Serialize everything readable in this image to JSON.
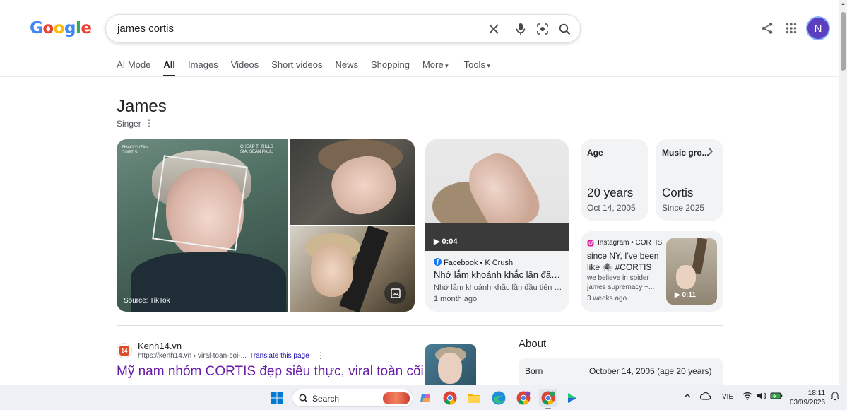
{
  "header": {
    "logo_letters": [
      {
        "ch": "G",
        "color": "#4285F4"
      },
      {
        "ch": "o",
        "color": "#EA4335"
      },
      {
        "ch": "o",
        "color": "#FBBC05"
      },
      {
        "ch": "g",
        "color": "#4285F4"
      },
      {
        "ch": "l",
        "color": "#34A853"
      },
      {
        "ch": "e",
        "color": "#EA4335"
      }
    ],
    "search_query": "james cortis",
    "avatar_letter": "N"
  },
  "tabs": [
    "AI Mode",
    "All",
    "Images",
    "Videos",
    "Short videos",
    "News",
    "Shopping",
    "More",
    "Tools"
  ],
  "active_tab": "All",
  "knowledge_panel": {
    "title": "James",
    "subtitle": "Singer",
    "main_image": {
      "caption_left": "ZHAO YUFAN\nCORTIS",
      "caption_right": "CHEAP THRILLS\nSIA, SEAN PAUL",
      "source": "Source: TikTok"
    },
    "facebook_card": {
      "duration": "0:04",
      "source": "Facebook • K Crush",
      "title": "Nhớ lắm khoảnh khắc lần đầu tiên...",
      "desc": "Nhớ lắm khoảnh khắc lần đầu tiên James...",
      "ago": "1 month ago"
    },
    "age_card": {
      "label": "Age",
      "value": "20 years",
      "sub": "Oct 14, 2005"
    },
    "music_card": {
      "label": "Music gro...",
      "value": "Cortis",
      "sub": "Since 2025"
    },
    "instagram_card": {
      "source": "Instagram • CORTIS",
      "title": "since NY, I've been like 🕷️ #CORTIS #...",
      "desc": "we believe in spider james supremacy ~...",
      "ago": "3 weeks ago",
      "duration": "0:11"
    }
  },
  "result": {
    "site": "Kenh14.vn",
    "url": "https://kenh14.vn › viral-toan-coi-...",
    "translate": "Translate this page",
    "title": "Mỹ nam nhóm CORTIS đẹp siêu thực, viral toàn cõi",
    "favicon_text": "14"
  },
  "about": {
    "heading": "About",
    "born_label": "Born",
    "born_value": "October 14, 2005 (age 20 years)"
  },
  "taskbar": {
    "search_label": "Search",
    "lang": "VIE",
    "time": "18:11",
    "date": "03/09/2026"
  }
}
